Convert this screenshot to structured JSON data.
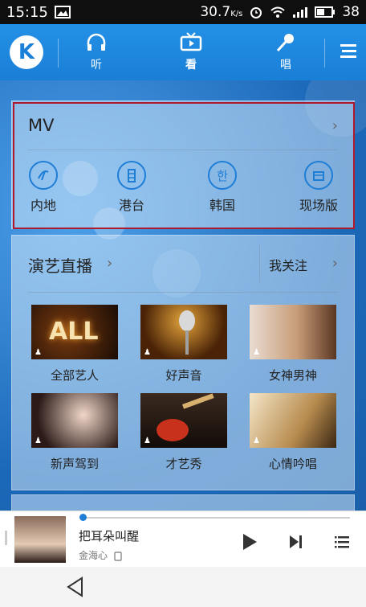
{
  "status": {
    "time": "15:15",
    "speed": "30.7",
    "speed_unit": "K/s",
    "battery": "38"
  },
  "tabs": [
    {
      "label": "听"
    },
    {
      "label": "看"
    },
    {
      "label": "唱"
    }
  ],
  "logo_letter": "K",
  "mv": {
    "title": "MV",
    "categories": [
      {
        "label": "内地",
        "icon": "mainland-icon"
      },
      {
        "label": "港台",
        "icon": "hktw-icon"
      },
      {
        "label": "韩国",
        "icon": "korea-icon",
        "glyph": "한"
      },
      {
        "label": "现场版",
        "icon": "live-version-icon"
      }
    ]
  },
  "live": {
    "title": "演艺直播",
    "follow_label": "我关注",
    "items": [
      {
        "label": "全部艺人",
        "overlay": "ALL"
      },
      {
        "label": "好声音"
      },
      {
        "label": "女神男神"
      },
      {
        "label": "新声驾到"
      },
      {
        "label": "才艺秀"
      },
      {
        "label": "心情吟唱"
      }
    ]
  },
  "player": {
    "song": "把耳朵叫醒",
    "artist": "金海心",
    "progress": 0.0
  },
  "colors": {
    "accent": "#1e7ed6",
    "appbar": "#2390e6",
    "highlight": "#b0182c"
  }
}
